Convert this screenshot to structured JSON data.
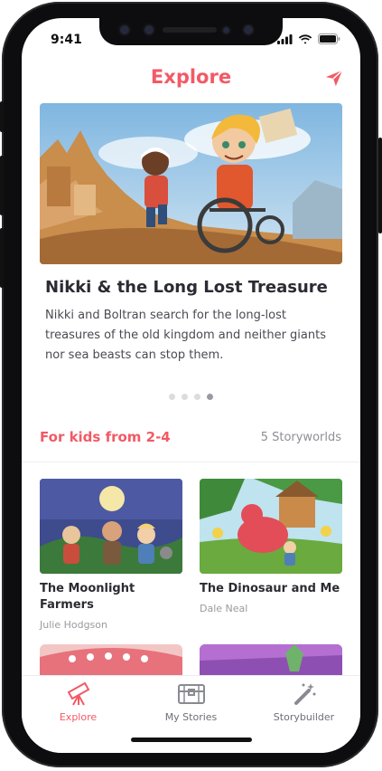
{
  "status_bar": {
    "time": "9:41"
  },
  "header": {
    "title": "Explore"
  },
  "featured": {
    "title": "Nikki & the Long Lost Treasure",
    "description": "Nikki and Boltran search for the long-lost treasures of the old kingdom and neither giants nor sea beasts can stop them.",
    "page_dots": 4,
    "active_dot": 4
  },
  "section": {
    "title": "For kids from 2-4",
    "count": "5 Storyworlds"
  },
  "cards": [
    {
      "title": "The Moonlight Farmers",
      "author": "Julie Hodgson"
    },
    {
      "title": "The Dinosaur and Me",
      "author": "Dale Neal"
    }
  ],
  "tabs": [
    {
      "label": "Explore",
      "icon": "telescope-icon",
      "active": true
    },
    {
      "label": "My Stories",
      "icon": "chest-icon",
      "active": false
    },
    {
      "label": "Storybuilder",
      "icon": "magic-wand-icon",
      "active": false
    }
  ],
  "colors": {
    "accent": "#f25a66",
    "text": "#2b2b33",
    "muted": "#8e8e95"
  }
}
